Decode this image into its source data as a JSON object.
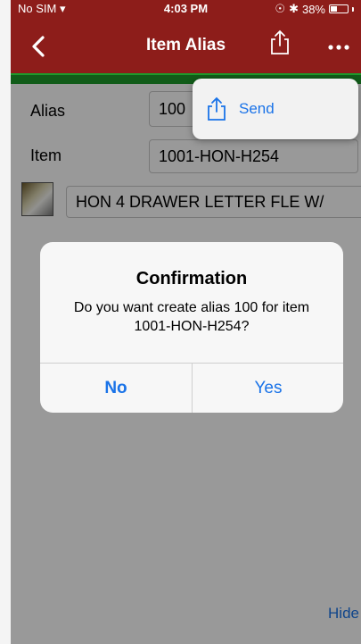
{
  "status_bar": {
    "carrier": "No SIM",
    "time": "4:03 PM",
    "battery": "38%",
    "battery_level": 0.38
  },
  "nav": {
    "title": "Item Alias",
    "back_icon": "chevron-left-icon",
    "share_icon": "share-icon",
    "more_icon": "more-icon"
  },
  "form": {
    "alias_label": "Alias",
    "alias_value": "100",
    "item_label": "Item",
    "item_value": "1001-HON-H254",
    "description": "HON 4 DRAWER LETTER FLE W/"
  },
  "popover": {
    "send_label": "Send",
    "send_icon": "share-icon"
  },
  "alert": {
    "title": "Confirmation",
    "message": "Do you want create alias 100 for item 1001-HON-H254?",
    "no_label": "No",
    "yes_label": "Yes"
  },
  "footer": {
    "hide_label": "Hide"
  },
  "colors": {
    "nav_bar": "#8d1d1a",
    "accent": "#1a73e8",
    "green_strip": "#1d9a2b"
  }
}
